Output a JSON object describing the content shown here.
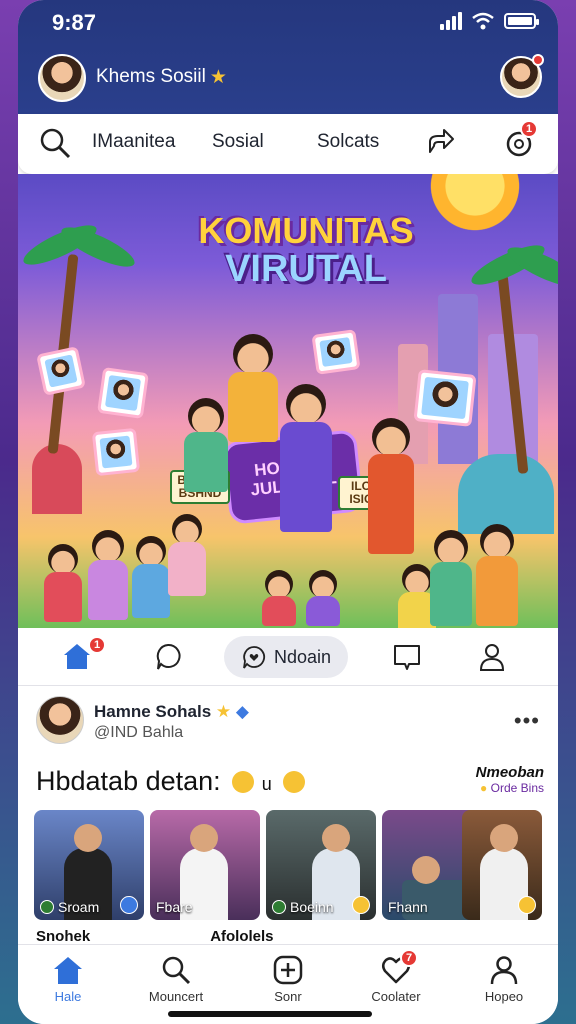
{
  "status_bar": {
    "time": "9:87"
  },
  "header": {
    "title": "Khems Sosiil"
  },
  "top_nav": {
    "items": [
      "IMaanitea",
      "Sosial",
      "Solcats"
    ],
    "notification_count": "1"
  },
  "hero": {
    "title_line1": "KOMUNITAS",
    "title_line2": "VIRUTAL",
    "sign_main": "HOMUI1,, JULARDH-",
    "sign_left": "BRSTIG BSHND",
    "sign_right": "ILO ISIC"
  },
  "tab_bar": {
    "home_badge": "1",
    "pill_label": "Ndoain"
  },
  "post": {
    "author_name": "Hamne Sohals",
    "author_handle": "@IND Bahla",
    "text": "Hbdatab detan:",
    "text_mid": "u",
    "side_title": "Nmeoban",
    "side_subtitle": "Orde Bins",
    "thumbs": [
      {
        "caption": "Sroam"
      },
      {
        "caption": "Fbare"
      },
      {
        "caption": "Boeinn"
      },
      {
        "caption": "Fhann"
      }
    ],
    "next_row": [
      "Snohek",
      "Afololels"
    ]
  },
  "bottom_nav": {
    "items": [
      {
        "label": "Hale",
        "icon": "home-icon"
      },
      {
        "label": "Mouncert",
        "icon": "search-icon"
      },
      {
        "label": "Sonr",
        "icon": "plus-square-icon"
      },
      {
        "label": "Coolater",
        "icon": "heart-icon",
        "badge": "7"
      },
      {
        "label": "Hopeo",
        "icon": "profile-icon"
      }
    ]
  },
  "colors": {
    "header_bg": "#25377e",
    "accent": "#3d7ae0",
    "badge": "#e53935"
  }
}
